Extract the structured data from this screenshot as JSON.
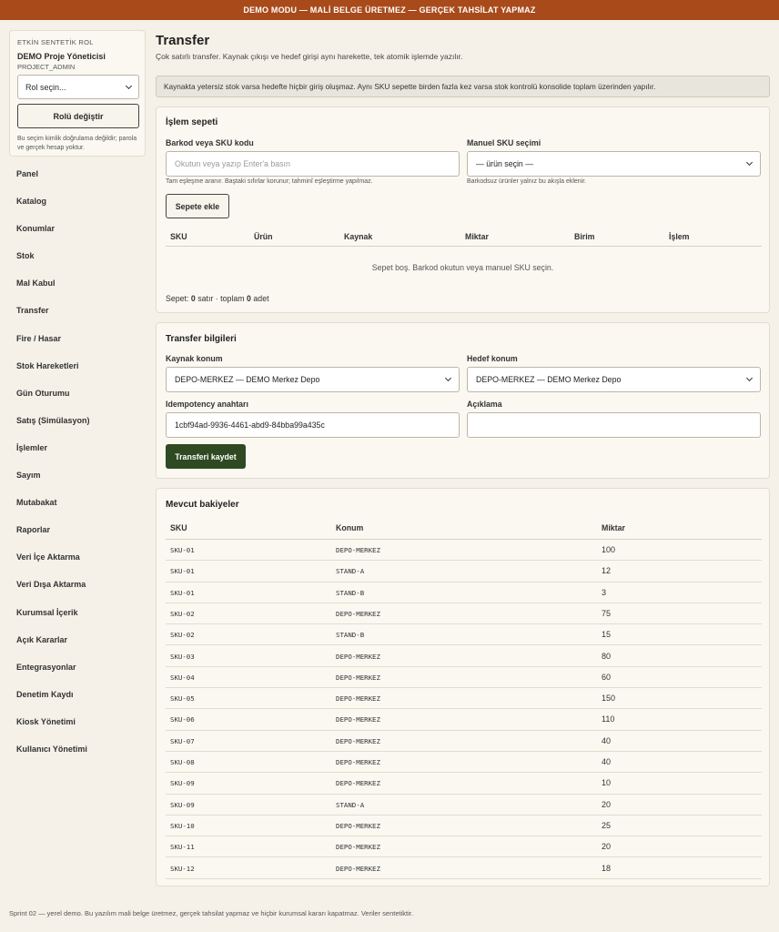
{
  "banner": "DEMO MODU — MALİ BELGE ÜRETMEZ — GERÇEK TAHSİLAT YAPMAZ",
  "role": {
    "kicker": "ETKİN SENTETİK ROL",
    "name": "DEMO Proje Yöneticisi",
    "code": "PROJECT_ADMIN",
    "select_value": "Rol seçin...",
    "change_button": "Rolü değiştir",
    "note": "Bu seçim kimlik doğrulama değildir; parola ve gerçek hesap yoktur."
  },
  "nav": [
    "Panel",
    "Katalog",
    "Konumlar",
    "Stok",
    "Mal Kabul",
    "Transfer",
    "Fire / Hasar",
    "Stok Hareketleri",
    "Gün Oturumu",
    "Satış (Simülasyon)",
    "İşlemler",
    "Sayım",
    "Mutabakat",
    "Raporlar",
    "Veri İçe Aktarma",
    "Veri Dışa Aktarma",
    "Kurumsal İçerik",
    "Açık Kararlar",
    "Entegrasyonlar",
    "Denetim Kaydı",
    "Kiosk Yönetimi",
    "Kullanıcı Yönetimi"
  ],
  "page": {
    "title": "Transfer",
    "subtitle": "Çok satırlı transfer. Kaynak çıkışı ve hedef girişi aynı harekette, tek atomik işlemde yazılır.",
    "alert": "Kaynakta yetersiz stok varsa hedefte hiçbir giriş oluşmaz. Aynı SKU sepette birden fazla kez varsa stok kontrolü konsolide toplam üzerinden yapılır."
  },
  "cart": {
    "title": "İşlem sepeti",
    "barcode_label": "Barkod veya SKU kodu",
    "barcode_placeholder": "Okutun veya yazıp Enter'a basın",
    "barcode_hint": "Tam eşleşme aranır. Baştaki sıfırlar korunur; tahminî eşleştirme yapılmaz.",
    "manual_label": "Manuel SKU seçimi",
    "manual_value": "— ürün seçin —",
    "manual_hint": "Barkodsuz ürünler yalnız bu akışla eklenir.",
    "add_button": "Sepete ekle",
    "columns": [
      "SKU",
      "Ürün",
      "Kaynak",
      "Miktar",
      "Birim",
      "İşlem"
    ],
    "empty_text": "Sepet boş. Barkod okutun veya manuel SKU seçin.",
    "summary_prefix": "Sepet:",
    "rows": "0",
    "rows_word": "satır · toplam",
    "total": "0",
    "total_word": "adet"
  },
  "transfer": {
    "title": "Transfer bilgileri",
    "source_label": "Kaynak konum",
    "source_value": "DEPO-MERKEZ — DEMO Merkez Depo",
    "target_label": "Hedef konum",
    "target_value": "DEPO-MERKEZ — DEMO Merkez Depo",
    "idem_label": "Idempotency anahtarı",
    "idem_value": "1cbf94ad-9936-4461-abd9-84bba99a435c",
    "desc_label": "Açıklama",
    "desc_value": "",
    "save_button": "Transferi kaydet"
  },
  "balances": {
    "title": "Mevcut bakiyeler",
    "columns": [
      "SKU",
      "Konum",
      "Miktar"
    ],
    "rows": [
      [
        "SKU-01",
        "DEPO-MERKEZ",
        "100"
      ],
      [
        "SKU-01",
        "STAND-A",
        "12"
      ],
      [
        "SKU-01",
        "STAND-B",
        "3"
      ],
      [
        "SKU-02",
        "DEPO-MERKEZ",
        "75"
      ],
      [
        "SKU-02",
        "STAND-B",
        "15"
      ],
      [
        "SKU-03",
        "DEPO-MERKEZ",
        "80"
      ],
      [
        "SKU-04",
        "DEPO-MERKEZ",
        "60"
      ],
      [
        "SKU-05",
        "DEPO-MERKEZ",
        "150"
      ],
      [
        "SKU-06",
        "DEPO-MERKEZ",
        "110"
      ],
      [
        "SKU-07",
        "DEPO-MERKEZ",
        "40"
      ],
      [
        "SKU-08",
        "DEPO-MERKEZ",
        "40"
      ],
      [
        "SKU-09",
        "DEPO-MERKEZ",
        "10"
      ],
      [
        "SKU-09",
        "STAND-A",
        "20"
      ],
      [
        "SKU-10",
        "DEPO-MERKEZ",
        "25"
      ],
      [
        "SKU-11",
        "DEPO-MERKEZ",
        "20"
      ],
      [
        "SKU-12",
        "DEPO-MERKEZ",
        "18"
      ]
    ]
  },
  "footer": "Sprint 02 — yerel demo. Bu yazılım mali belge üretmez, gerçek tahsilat yapmaz ve hiçbir kurumsal kararı kapatmaz. Veriler sentetiktir."
}
